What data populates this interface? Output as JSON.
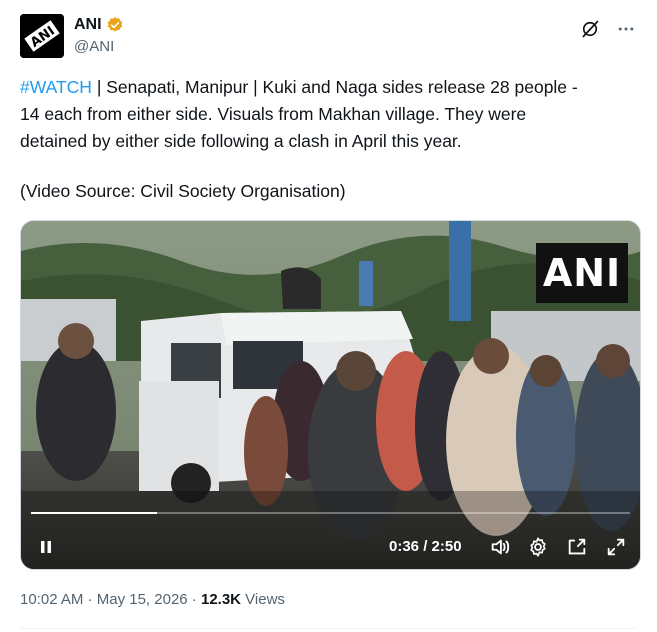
{
  "account": {
    "display_name": "ANI",
    "handle": "@ANI",
    "avatar_text": "ANI",
    "verified": true
  },
  "tweet": {
    "hashtag": "#WATCH",
    "line1_rest": " | Senapati, Manipur | Kuki and Naga sides release 28 people -",
    "line2": "14 each from either side. Visuals from Makhan village. They were",
    "line3": "detained by either side following a clash in April this year.",
    "source": "(Video Source: Civil Society Organisation)"
  },
  "video": {
    "watermark": "ANI",
    "current_time": "0:36",
    "separator": " / ",
    "duration": "2:50",
    "progress_fraction": 0.21
  },
  "meta": {
    "time": "10:02 AM",
    "dot1": " · ",
    "date": "May 15, 2026",
    "dot2": " · ",
    "views_count": "12.3K",
    "views_label": " Views"
  },
  "icons": {
    "grok": "grok-icon",
    "more": "more-dots-icon",
    "play_pause": "pause-icon",
    "volume": "volume-icon",
    "settings": "gear-icon",
    "pip": "picture-in-picture-icon",
    "fullscreen": "fullscreen-icon"
  },
  "colors": {
    "link": "#1d9bf0",
    "verified_badge": "#e8a318",
    "text": "#0f1419",
    "muted": "#536471"
  }
}
